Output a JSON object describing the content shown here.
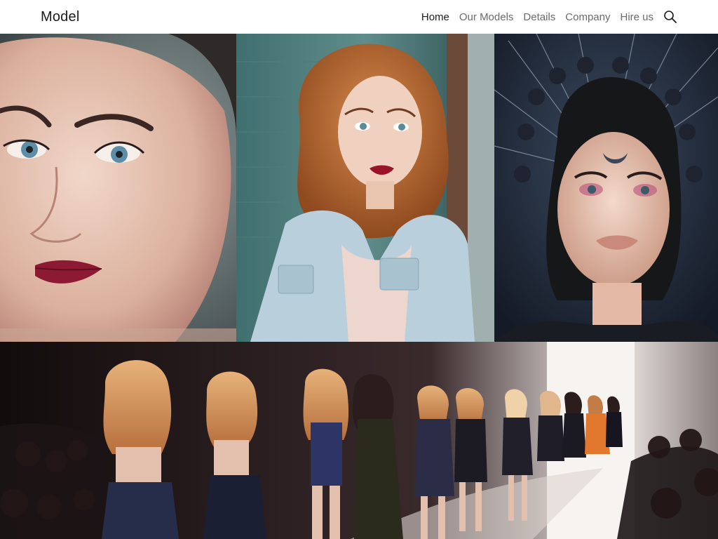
{
  "brand": {
    "name": "Model"
  },
  "nav": {
    "items": [
      {
        "label": "Home",
        "active": true
      },
      {
        "label": "Our Models",
        "active": false
      },
      {
        "label": "Details",
        "active": false
      },
      {
        "label": "Company",
        "active": false
      },
      {
        "label": "Hire us",
        "active": false
      }
    ],
    "search_icon": "search-icon"
  },
  "colors": {
    "text_active": "#1c1c1c",
    "text_muted": "#6b6b6b",
    "background": "#ffffff"
  }
}
